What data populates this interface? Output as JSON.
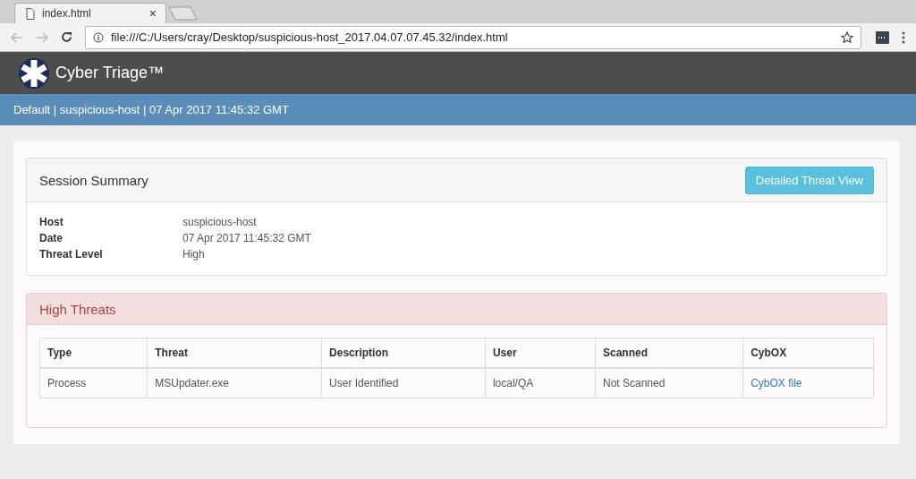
{
  "browser": {
    "tab_title": "index.html",
    "tab_close": "×",
    "address": "file:///C:/Users/cray/Desktop/suspicious-host_2017.04.07.07.45.32/index.html"
  },
  "header": {
    "brand": "Cyber Triage™"
  },
  "context_bar": {
    "text": "Default | suspicious-host | 07 Apr 2017 11:45:32 GMT"
  },
  "session_summary": {
    "title": "Session Summary",
    "button": "Detailed Threat View",
    "fields": [
      {
        "label": "Host",
        "value": "suspicious-host"
      },
      {
        "label": "Date",
        "value": "07 Apr 2017 11:45:32 GMT"
      },
      {
        "label": "Threat Level",
        "value": "High"
      }
    ]
  },
  "high_threats": {
    "title": "High Threats",
    "table": {
      "columns": [
        "Type",
        "Threat",
        "Description",
        "User",
        "Scanned",
        "CybOX"
      ],
      "rows": [
        [
          {
            "kind": "text",
            "text": "Process"
          },
          {
            "kind": "text",
            "text": "MSUpdater.exe"
          },
          {
            "kind": "text",
            "text": "User Identified"
          },
          {
            "kind": "text",
            "text": "local/QA"
          },
          {
            "kind": "text",
            "text": "Not Scanned"
          },
          {
            "kind": "link",
            "text": "CybOX file"
          }
        ]
      ]
    }
  }
}
